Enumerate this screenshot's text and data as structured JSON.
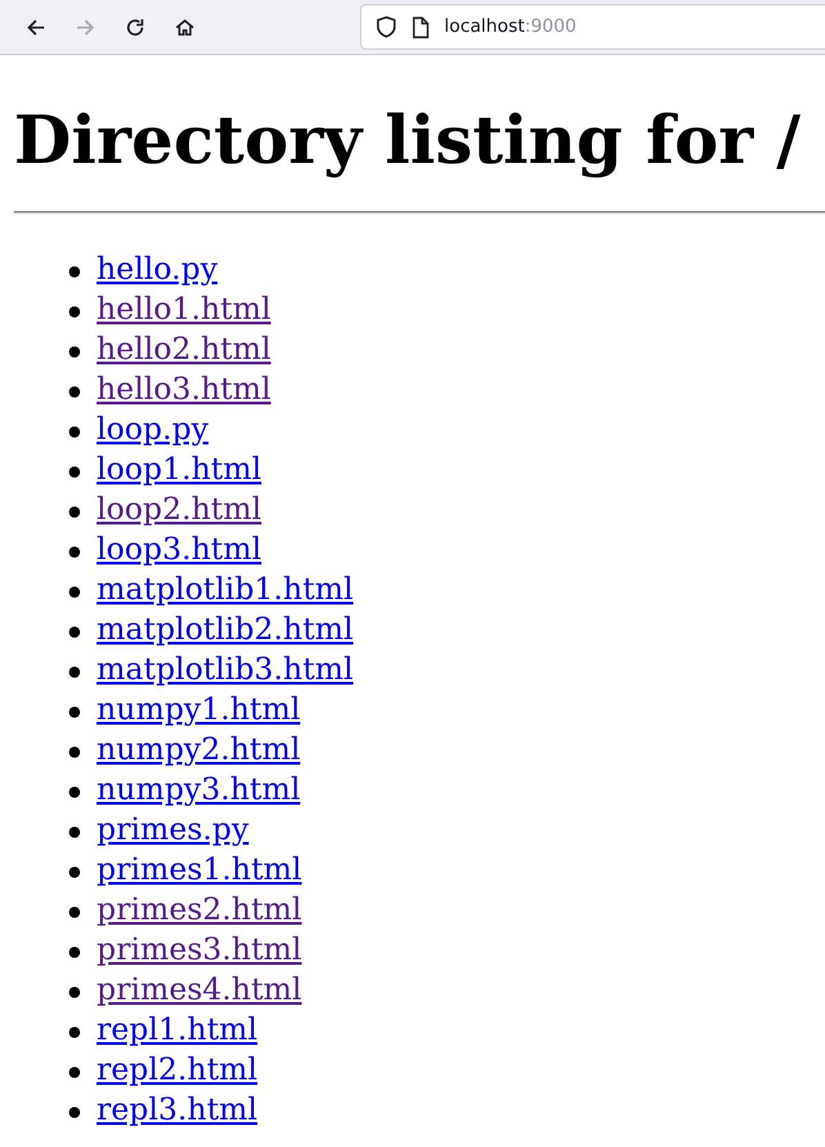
{
  "toolbar": {
    "back": {
      "disabled": false
    },
    "forward": {
      "disabled": true
    },
    "address": {
      "host": "localhost",
      "port": ":9000"
    }
  },
  "page": {
    "heading": "Directory listing for /",
    "files": [
      {
        "name": "hello.py",
        "visited": false
      },
      {
        "name": "hello1.html",
        "visited": true
      },
      {
        "name": "hello2.html",
        "visited": true
      },
      {
        "name": "hello3.html",
        "visited": true
      },
      {
        "name": "loop.py",
        "visited": false
      },
      {
        "name": "loop1.html",
        "visited": false
      },
      {
        "name": "loop2.html",
        "visited": true
      },
      {
        "name": "loop3.html",
        "visited": false
      },
      {
        "name": "matplotlib1.html",
        "visited": false
      },
      {
        "name": "matplotlib2.html",
        "visited": false
      },
      {
        "name": "matplotlib3.html",
        "visited": false
      },
      {
        "name": "numpy1.html",
        "visited": false
      },
      {
        "name": "numpy2.html",
        "visited": false
      },
      {
        "name": "numpy3.html",
        "visited": false
      },
      {
        "name": "primes.py",
        "visited": false
      },
      {
        "name": "primes1.html",
        "visited": false
      },
      {
        "name": "primes2.html",
        "visited": true
      },
      {
        "name": "primes3.html",
        "visited": true
      },
      {
        "name": "primes4.html",
        "visited": true
      },
      {
        "name": "repl1.html",
        "visited": false
      },
      {
        "name": "repl2.html",
        "visited": false
      },
      {
        "name": "repl3.html",
        "visited": false
      }
    ]
  }
}
